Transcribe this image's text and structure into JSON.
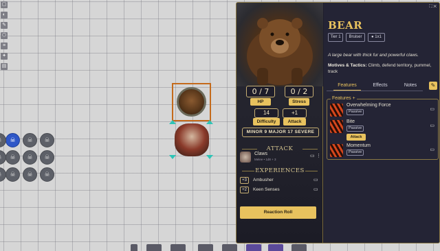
{
  "canvas": {
    "tool_icons": [
      "map-icon",
      "token-icon",
      "ruler-icon",
      "draw-icon",
      "note-icon",
      "lighting-icon",
      "journal-icon"
    ],
    "tool_glyphs": [
      "▢",
      "◐",
      "✎",
      "⬡",
      "≡",
      "✦",
      "▤"
    ],
    "grid_token_glyph": "☠",
    "bottom_slots": 8
  },
  "sheet": {
    "top_icons": "⛶ ✕",
    "name": "BEAR",
    "tags": {
      "tier": "Tier 1",
      "type": "Bruiser",
      "size": "1x1"
    },
    "description": "A large bear with thick fur and powerful claws.",
    "motives_label": "Motives & Tactics:",
    "motives_text": " Climb, defend territory, pummel, track",
    "stats": {
      "hp_value": "0 / 7",
      "hp_label": "HP",
      "stress_value": "0 / 2",
      "stress_label": "Stress",
      "difficulty_value": "14",
      "difficulty_label": "Difficulty",
      "attack_value": "+1",
      "attack_label": "Attack"
    },
    "thresholds": {
      "minor_label": "MINOR",
      "minor": "9",
      "major_label": "MAJOR",
      "major": "17",
      "severe_label": "SEVERE"
    },
    "attack_section": {
      "title": "ATTACK",
      "name": "Claws",
      "subtitle": "Melee • 1d8 + 3",
      "chat_glyph": "▭",
      "menu_glyph": "⋮"
    },
    "experiences_section": {
      "title": "EXPERIENCES",
      "items": [
        {
          "mod": "+3",
          "name": "Ambusher"
        },
        {
          "mod": "+2",
          "name": "Keen Senses"
        }
      ]
    },
    "reaction_button": "Reaction Roll",
    "tabs": {
      "features": "Features",
      "effects": "Effects",
      "notes": "Notes"
    },
    "wrench_glyph": "✎",
    "features": {
      "title": "Features +",
      "items": [
        {
          "name": "Overwhelming Force",
          "tag": "Passive"
        },
        {
          "name": "Bite",
          "tag": "Passive",
          "action": "Attack"
        },
        {
          "name": "Momentum",
          "tag": "Passive"
        }
      ]
    }
  }
}
